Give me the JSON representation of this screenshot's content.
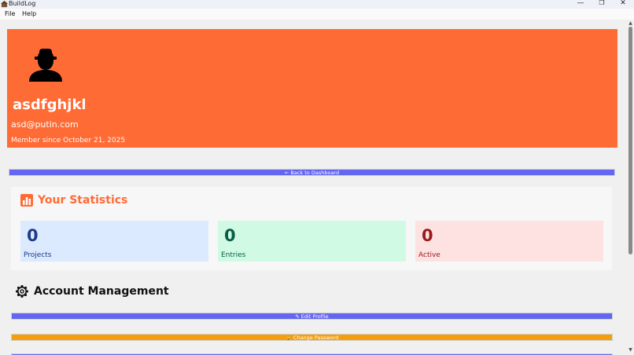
{
  "window": {
    "title": "BuildLog",
    "minimize": "—",
    "maximize": "❐",
    "close": "✕"
  },
  "menu": {
    "file": "File",
    "help": "Help"
  },
  "profile": {
    "username": "asdfghjkl",
    "email": "asd@putin.com",
    "member_since": "Member since October 21, 2025",
    "header_color": "#ff6b35"
  },
  "buttons": {
    "back": "← Back to Dashboard",
    "edit_profile": "✎ Edit Profile",
    "change_password": "🔒 Change Password",
    "primary_color": "#6366f1",
    "warning_color": "#f59e0b"
  },
  "stats": {
    "title": "Your Statistics",
    "cards": [
      {
        "value": "0",
        "label": "Projects"
      },
      {
        "value": "0",
        "label": "Entries"
      },
      {
        "value": "0",
        "label": "Active"
      }
    ]
  },
  "account": {
    "title": "Account Management"
  }
}
